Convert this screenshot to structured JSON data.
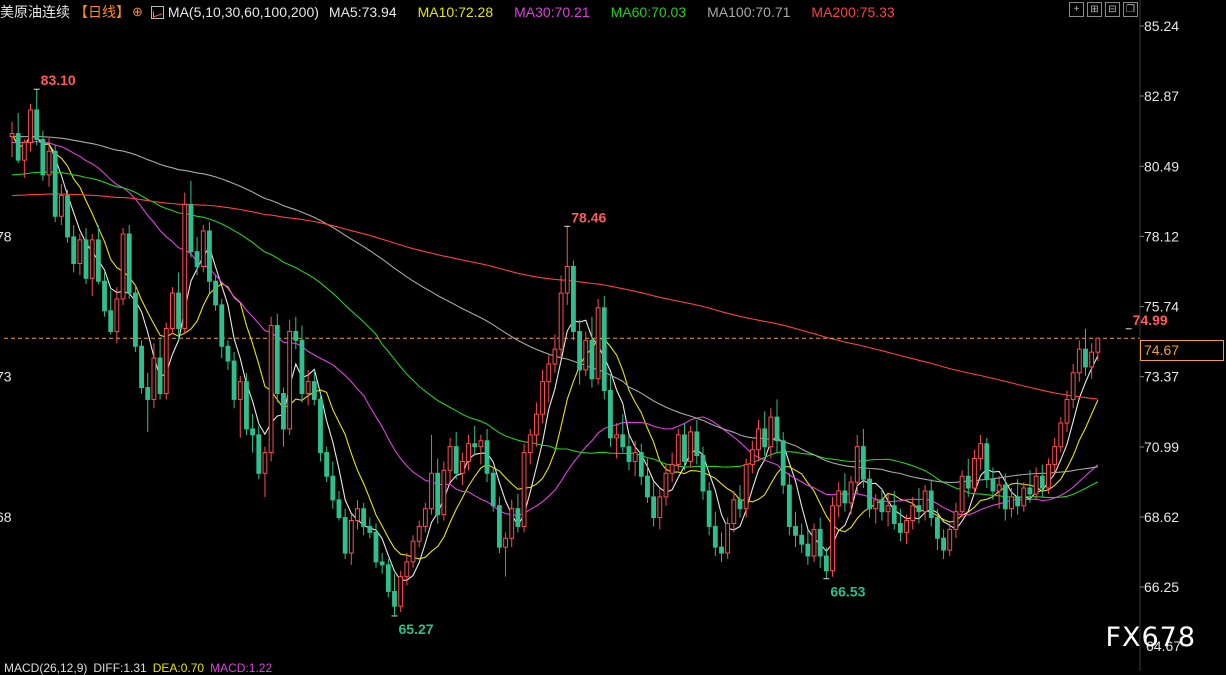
{
  "header": {
    "title": "美原油连续",
    "period": "【日线】",
    "ma_params": "MA(5,10,30,60,100,200)",
    "ma_values": [
      {
        "label": "MA5:73.94",
        "color": "#e8e8e8"
      },
      {
        "label": "MA10:72.28",
        "color": "#e6e600"
      },
      {
        "label": "MA30:70.21",
        "color": "#e040e0"
      },
      {
        "label": "MA60:70.03",
        "color": "#20d020"
      },
      {
        "label": "MA100:70.71",
        "color": "#a8a8a8"
      },
      {
        "label": "MA200:75.33",
        "color": "#ff4040"
      }
    ]
  },
  "toolbar_icons": [
    "crosshair-icon",
    "zoom-in-icon",
    "zoom-out-icon",
    "window-icon"
  ],
  "footer": {
    "macd": "MACD(26,12,9)",
    "diff": "DIFF:1.31",
    "dea": "DEA:0.70",
    "macd_value": "MACD:1.22"
  },
  "current_price": "74.67",
  "watermark": "FX678",
  "colors": {
    "up": "#ff4d4d",
    "down": "#2fbf8f",
    "current_line": "#f0a030"
  },
  "chart_data": {
    "type": "candlestick",
    "title": "美原油连续 日线",
    "y_ticks": [
      "85.24",
      "82.87",
      "80.49",
      "78.12",
      "75.74",
      "73.37",
      "70.99",
      "68.62",
      "66.25"
    ],
    "y_partial_ticks": [
      "78",
      "73",
      "68"
    ],
    "ylim": [
      64.67,
      85.24
    ],
    "annotations": [
      {
        "label": "83.10",
        "value": 83.1,
        "kind": "high",
        "bar": 4
      },
      {
        "label": "78.46",
        "value": 78.46,
        "kind": "high",
        "bar": 90
      },
      {
        "label": "65.27",
        "value": 65.27,
        "kind": "low",
        "bar": 62
      },
      {
        "label": "66.53",
        "value": 66.53,
        "kind": "low",
        "bar": 132
      },
      {
        "label": "74.99",
        "value": 74.99,
        "kind": "high",
        "bar": 181
      }
    ],
    "current_price": 74.67,
    "bottom_value": "64.67",
    "candles": [
      [
        81.5,
        82.0,
        80.8,
        81.6
      ],
      [
        81.6,
        82.3,
        80.6,
        80.7
      ],
      [
        80.7,
        81.4,
        80.1,
        81.3
      ],
      [
        81.3,
        82.6,
        81.0,
        82.4
      ],
      [
        82.4,
        83.1,
        81.2,
        81.4
      ],
      [
        81.4,
        81.7,
        80.0,
        80.2
      ],
      [
        80.2,
        81.5,
        79.8,
        81.0
      ],
      [
        81.0,
        81.2,
        78.6,
        78.8
      ],
      [
        78.8,
        79.9,
        78.5,
        79.5
      ],
      [
        79.5,
        79.7,
        77.9,
        78.1
      ],
      [
        78.1,
        78.5,
        76.9,
        77.2
      ],
      [
        77.2,
        78.2,
        76.8,
        78.0
      ],
      [
        78.0,
        78.4,
        76.5,
        76.7
      ],
      [
        76.7,
        78.2,
        76.1,
        78.0
      ],
      [
        78.0,
        78.5,
        76.5,
        76.6
      ],
      [
        76.6,
        76.9,
        75.4,
        75.6
      ],
      [
        75.6,
        76.3,
        74.8,
        74.9
      ],
      [
        74.9,
        76.4,
        74.5,
        76.0
      ],
      [
        76.0,
        78.4,
        75.8,
        78.2
      ],
      [
        78.2,
        78.5,
        76.0,
        76.2
      ],
      [
        76.2,
        76.5,
        74.2,
        74.4
      ],
      [
        74.4,
        74.6,
        72.8,
        73.0
      ],
      [
        73.0,
        73.5,
        71.5,
        72.6
      ],
      [
        72.6,
        74.5,
        72.3,
        74.0
      ],
      [
        74.0,
        74.7,
        72.6,
        72.8
      ],
      [
        72.8,
        75.2,
        72.6,
        75.0
      ],
      [
        75.0,
        76.4,
        74.8,
        76.2
      ],
      [
        76.2,
        76.9,
        74.6,
        75.0
      ],
      [
        75.0,
        79.6,
        74.8,
        79.2
      ],
      [
        79.2,
        80.0,
        77.4,
        77.6
      ],
      [
        77.6,
        78.1,
        76.8,
        77.1
      ],
      [
        77.1,
        78.5,
        76.9,
        78.3
      ],
      [
        78.3,
        78.6,
        76.2,
        76.6
      ],
      [
        76.6,
        76.8,
        75.6,
        75.8
      ],
      [
        75.8,
        76.0,
        74.0,
        74.4
      ],
      [
        74.4,
        74.6,
        73.6,
        73.9
      ],
      [
        73.9,
        74.2,
        72.3,
        72.6
      ],
      [
        72.6,
        73.4,
        71.3,
        73.2
      ],
      [
        73.2,
        73.5,
        71.4,
        71.6
      ],
      [
        71.6,
        72.1,
        70.8,
        71.4
      ],
      [
        71.4,
        71.7,
        69.9,
        70.1
      ],
      [
        70.1,
        71.0,
        69.3,
        70.8
      ],
      [
        70.8,
        75.4,
        70.5,
        75.1
      ],
      [
        75.1,
        75.5,
        72.5,
        72.8
      ],
      [
        72.8,
        73.0,
        71.0,
        71.6
      ],
      [
        71.6,
        75.3,
        71.4,
        74.9
      ],
      [
        74.9,
        75.4,
        74.3,
        74.6
      ],
      [
        74.6,
        75.1,
        72.5,
        72.8
      ],
      [
        72.8,
        73.6,
        72.4,
        73.2
      ],
      [
        73.2,
        73.6,
        72.4,
        72.6
      ],
      [
        72.6,
        72.8,
        70.5,
        70.8
      ],
      [
        70.8,
        71.0,
        69.8,
        70.0
      ],
      [
        70.0,
        70.5,
        68.9,
        69.2
      ],
      [
        69.2,
        69.5,
        68.5,
        68.6
      ],
      [
        68.6,
        68.9,
        67.2,
        67.4
      ],
      [
        67.4,
        68.7,
        67.0,
        68.5
      ],
      [
        68.5,
        69.2,
        68.2,
        68.9
      ],
      [
        68.9,
        69.1,
        68.0,
        68.3
      ],
      [
        68.3,
        68.6,
        67.9,
        68.1
      ],
      [
        68.1,
        68.4,
        66.9,
        67.1
      ],
      [
        67.1,
        67.4,
        66.7,
        67.0
      ],
      [
        67.0,
        67.2,
        65.9,
        66.1
      ],
      [
        66.1,
        66.7,
        65.3,
        65.6
      ],
      [
        65.6,
        66.8,
        65.4,
        66.6
      ],
      [
        66.6,
        67.4,
        66.3,
        67.1
      ],
      [
        67.1,
        68.0,
        66.9,
        67.8
      ],
      [
        67.8,
        68.5,
        67.6,
        68.3
      ],
      [
        68.3,
        69.1,
        68.1,
        68.9
      ],
      [
        68.9,
        71.4,
        68.7,
        70.1
      ],
      [
        70.1,
        70.6,
        68.4,
        68.7
      ],
      [
        68.7,
        70.5,
        68.5,
        70.2
      ],
      [
        70.2,
        71.3,
        69.8,
        71.0
      ],
      [
        71.0,
        71.5,
        69.9,
        70.1
      ],
      [
        70.1,
        70.8,
        69.7,
        70.5
      ],
      [
        70.5,
        71.4,
        70.2,
        71.1
      ],
      [
        71.1,
        71.7,
        70.7,
        71.0
      ],
      [
        71.0,
        71.4,
        70.4,
        71.2
      ],
      [
        71.2,
        71.6,
        69.8,
        70.1
      ],
      [
        70.1,
        70.3,
        68.8,
        69.0
      ],
      [
        69.0,
        69.3,
        67.4,
        67.6
      ],
      [
        67.6,
        68.1,
        66.6,
        67.9
      ],
      [
        67.9,
        69.2,
        67.6,
        68.9
      ],
      [
        68.9,
        69.4,
        68.1,
        68.3
      ],
      [
        68.3,
        71.1,
        68.1,
        70.8
      ],
      [
        70.8,
        71.6,
        70.4,
        71.4
      ],
      [
        71.4,
        72.5,
        71.0,
        72.1
      ],
      [
        72.1,
        73.6,
        71.8,
        73.2
      ],
      [
        73.2,
        74.1,
        72.5,
        73.8
      ],
      [
        73.8,
        74.8,
        73.5,
        74.3
      ],
      [
        74.3,
        76.8,
        74.0,
        76.2
      ],
      [
        76.2,
        78.46,
        75.8,
        77.1
      ],
      [
        77.1,
        77.3,
        74.6,
        74.9
      ],
      [
        74.9,
        75.3,
        73.1,
        73.6
      ],
      [
        73.6,
        74.9,
        73.4,
        74.6
      ],
      [
        74.6,
        75.4,
        73.0,
        73.3
      ],
      [
        73.3,
        76.0,
        73.1,
        75.7
      ],
      [
        75.7,
        76.1,
        72.6,
        72.9
      ],
      [
        72.9,
        73.4,
        71.0,
        71.3
      ],
      [
        71.3,
        71.8,
        70.6,
        71.4
      ],
      [
        71.4,
        72.1,
        70.8,
        71.0
      ],
      [
        71.0,
        71.4,
        70.2,
        70.5
      ],
      [
        70.5,
        71.2,
        70.0,
        70.8
      ],
      [
        70.8,
        71.1,
        69.7,
        70.0
      ],
      [
        70.0,
        70.6,
        69.1,
        69.3
      ],
      [
        69.3,
        69.8,
        68.3,
        68.6
      ],
      [
        68.6,
        69.6,
        68.2,
        69.3
      ],
      [
        69.3,
        70.4,
        69.0,
        70.1
      ],
      [
        70.1,
        70.8,
        69.8,
        70.4
      ],
      [
        70.4,
        71.6,
        70.2,
        71.4
      ],
      [
        71.4,
        71.8,
        70.2,
        70.5
      ],
      [
        70.5,
        71.7,
        70.3,
        71.5
      ],
      [
        71.5,
        71.9,
        70.4,
        70.7
      ],
      [
        70.7,
        71.0,
        69.2,
        69.5
      ],
      [
        69.5,
        69.8,
        68.0,
        68.3
      ],
      [
        68.3,
        68.8,
        67.3,
        67.6
      ],
      [
        67.6,
        68.1,
        67.1,
        67.4
      ],
      [
        67.4,
        68.6,
        67.2,
        68.4
      ],
      [
        68.4,
        69.5,
        68.1,
        69.2
      ],
      [
        69.2,
        69.7,
        68.6,
        68.9
      ],
      [
        68.9,
        70.6,
        68.6,
        70.4
      ],
      [
        70.4,
        71.2,
        70.1,
        70.9
      ],
      [
        70.9,
        71.9,
        70.5,
        71.6
      ],
      [
        71.6,
        72.2,
        70.7,
        71.0
      ],
      [
        71.0,
        72.3,
        70.6,
        72.0
      ],
      [
        72.0,
        72.6,
        70.8,
        71.2
      ],
      [
        71.2,
        71.5,
        69.4,
        69.7
      ],
      [
        69.7,
        70.1,
        68.0,
        68.3
      ],
      [
        68.3,
        68.8,
        67.6,
        68.0
      ],
      [
        68.0,
        68.4,
        67.4,
        67.7
      ],
      [
        67.7,
        68.2,
        67.0,
        67.3
      ],
      [
        67.3,
        68.4,
        67.1,
        68.2
      ],
      [
        68.2,
        68.6,
        66.9,
        67.3
      ],
      [
        67.3,
        67.6,
        66.53,
        66.8
      ],
      [
        66.8,
        69.3,
        66.6,
        69.0
      ],
      [
        69.0,
        69.8,
        68.6,
        69.5
      ],
      [
        69.5,
        70.1,
        68.8,
        69.1
      ],
      [
        69.1,
        70.0,
        68.7,
        69.8
      ],
      [
        69.8,
        71.4,
        69.4,
        71.0
      ],
      [
        71.0,
        71.6,
        69.6,
        69.9
      ],
      [
        69.9,
        70.2,
        68.6,
        68.9
      ],
      [
        68.9,
        69.4,
        68.4,
        69.2
      ],
      [
        69.2,
        69.6,
        68.5,
        68.8
      ],
      [
        68.8,
        69.4,
        68.3,
        69.0
      ],
      [
        69.0,
        69.5,
        68.2,
        68.4
      ],
      [
        68.4,
        68.9,
        67.8,
        68.1
      ],
      [
        68.1,
        68.7,
        67.7,
        68.5
      ],
      [
        68.5,
        69.3,
        68.2,
        69.0
      ],
      [
        69.0,
        69.6,
        68.4,
        68.8
      ],
      [
        68.8,
        69.7,
        68.5,
        69.5
      ],
      [
        69.5,
        69.9,
        68.3,
        68.6
      ],
      [
        68.6,
        68.9,
        67.5,
        67.9
      ],
      [
        67.9,
        68.2,
        67.2,
        67.5
      ],
      [
        67.5,
        68.4,
        67.3,
        68.2
      ],
      [
        68.2,
        69.1,
        67.9,
        68.8
      ],
      [
        68.8,
        70.2,
        68.6,
        70.0
      ],
      [
        70.0,
        70.6,
        69.3,
        69.6
      ],
      [
        69.6,
        70.9,
        69.4,
        70.6
      ],
      [
        70.6,
        71.4,
        70.2,
        71.1
      ],
      [
        71.1,
        71.3,
        69.6,
        69.9
      ],
      [
        69.9,
        70.3,
        69.2,
        69.5
      ],
      [
        69.5,
        70.0,
        68.9,
        69.7
      ],
      [
        69.7,
        70.1,
        68.5,
        68.9
      ],
      [
        68.9,
        69.6,
        68.6,
        69.3
      ],
      [
        69.3,
        69.9,
        68.7,
        69.0
      ],
      [
        69.0,
        69.8,
        68.8,
        69.6
      ],
      [
        69.6,
        70.2,
        69.1,
        69.4
      ],
      [
        69.4,
        70.3,
        69.2,
        70.0
      ],
      [
        70.0,
        70.4,
        69.3,
        69.6
      ],
      [
        69.6,
        70.6,
        69.4,
        70.4
      ],
      [
        70.4,
        71.3,
        70.1,
        71.0
      ],
      [
        71.0,
        72.0,
        70.8,
        71.8
      ],
      [
        71.8,
        72.9,
        71.5,
        72.6
      ],
      [
        72.6,
        73.8,
        72.3,
        73.5
      ],
      [
        73.5,
        74.6,
        73.2,
        74.3
      ],
      [
        74.3,
        74.99,
        73.4,
        73.7
      ],
      [
        73.7,
        74.5,
        73.3,
        74.2
      ],
      [
        74.2,
        74.6,
        73.9,
        74.67
      ]
    ],
    "moving_averages": [
      {
        "name": "MA5",
        "period": 5,
        "color": "#e8e8e8"
      },
      {
        "name": "MA10",
        "period": 10,
        "color": "#e6e600"
      },
      {
        "name": "MA30",
        "period": 30,
        "color": "#e040e0"
      },
      {
        "name": "MA60",
        "period": 60,
        "color": "#20d020"
      },
      {
        "name": "MA100",
        "period": 100,
        "color": "#a8a8a8"
      },
      {
        "name": "MA200",
        "period": 200,
        "color": "#ff4040"
      }
    ]
  }
}
